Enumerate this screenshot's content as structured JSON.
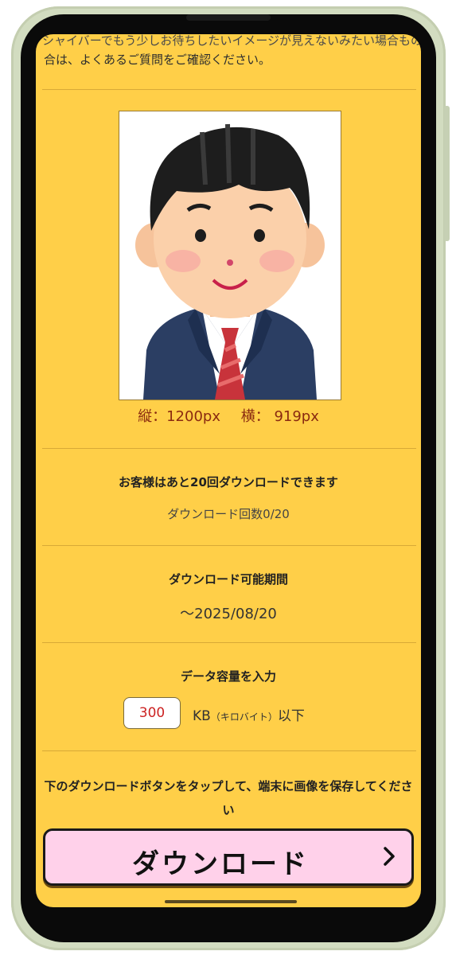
{
  "intro": {
    "line1": "シャイバーでもう少しお待ちしたいイメージが見えないみたい場合ものでいます",
    "line2": "合は、よくあるご質問をご確認ください。"
  },
  "photo": {
    "icon": "businessman-portrait"
  },
  "dimensions": {
    "height_label": "縦：1200px",
    "width_label": "横： 919px"
  },
  "download_count": {
    "title": "お客様はあと20回ダウンロードできます",
    "count_label": "ダウンロード回数0/20"
  },
  "download_period": {
    "title": "ダウンロード可能期間",
    "period": "～2025/08/20"
  },
  "data_size": {
    "title": "データ容量を入力",
    "value": "300",
    "unit_main": "KB",
    "unit_paren": "（キロバイト）",
    "unit_suffix": "以下"
  },
  "instruction": "下のダウンロードボタンをタップして、端末に画像を保存してください",
  "download_button": {
    "label": "ダウンロード",
    "icon": "chevron-right-icon"
  },
  "colors": {
    "screen_bg": "#ffcf48",
    "button_bg": "#ffd1ea",
    "accent_text": "#8a2a10"
  }
}
